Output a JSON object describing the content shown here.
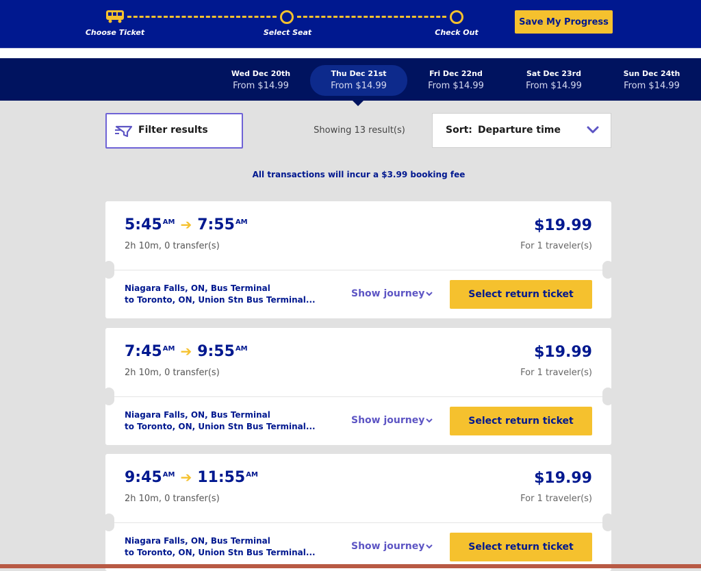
{
  "progress": {
    "steps": [
      {
        "label": "Choose Ticket",
        "icon": "bus-icon"
      },
      {
        "label": "Select Seat",
        "icon": "circle-icon"
      },
      {
        "label": "Check Out",
        "icon": "circle-icon"
      }
    ],
    "save_label": "Save My Progress",
    "accent_color": "#f5c12e",
    "brand_color": "#00188f"
  },
  "dates": [
    {
      "day": "Wed Dec 20th",
      "price": "From $14.99",
      "active": false
    },
    {
      "day": "Thu Dec 21st",
      "price": "From $14.99",
      "active": true
    },
    {
      "day": "Fri Dec 22nd",
      "price": "From $14.99",
      "active": false
    },
    {
      "day": "Sat Dec 23rd",
      "price": "From $14.99",
      "active": false
    },
    {
      "day": "Sun Dec 24th",
      "price": "From $14.99",
      "active": false
    }
  ],
  "filter": {
    "label": "Filter results",
    "icon": "filter-icon"
  },
  "results": {
    "count_text": "Showing 13 result(s)"
  },
  "sort": {
    "label": "Sort:",
    "value": "Departure time",
    "icon": "chevron-down-icon"
  },
  "booking_fee": "All transactions will incur a $3.99 booking fee",
  "trips": [
    {
      "depart": "5:45",
      "depart_ampm": "AM",
      "arrive": "7:55",
      "arrive_ampm": "AM",
      "duration": "2h 10m, 0 transfer(s)",
      "price": "$19.99",
      "price_note": "For 1 traveler(s)",
      "from": "Niagara Falls, ON, Bus Terminal",
      "to": "to  Toronto, ON, Union Stn Bus Terminal...",
      "journey_label": "Show journey",
      "select_label": "Select return ticket"
    },
    {
      "depart": "7:45",
      "depart_ampm": "AM",
      "arrive": "9:55",
      "arrive_ampm": "AM",
      "duration": "2h 10m, 0 transfer(s)",
      "price": "$19.99",
      "price_note": "For 1 traveler(s)",
      "from": "Niagara Falls, ON, Bus Terminal",
      "to": "to  Toronto, ON, Union Stn Bus Terminal...",
      "journey_label": "Show journey",
      "select_label": "Select return ticket"
    },
    {
      "depart": "9:45",
      "depart_ampm": "AM",
      "arrive": "11:55",
      "arrive_ampm": "AM",
      "duration": "2h 10m, 0 transfer(s)",
      "price": "$19.99",
      "price_note": "For 1 traveler(s)",
      "from": "Niagara Falls, ON, Bus Terminal",
      "to": "to  Toronto, ON, Union Stn Bus Terminal...",
      "journey_label": "Show journey",
      "select_label": "Select return ticket"
    }
  ]
}
